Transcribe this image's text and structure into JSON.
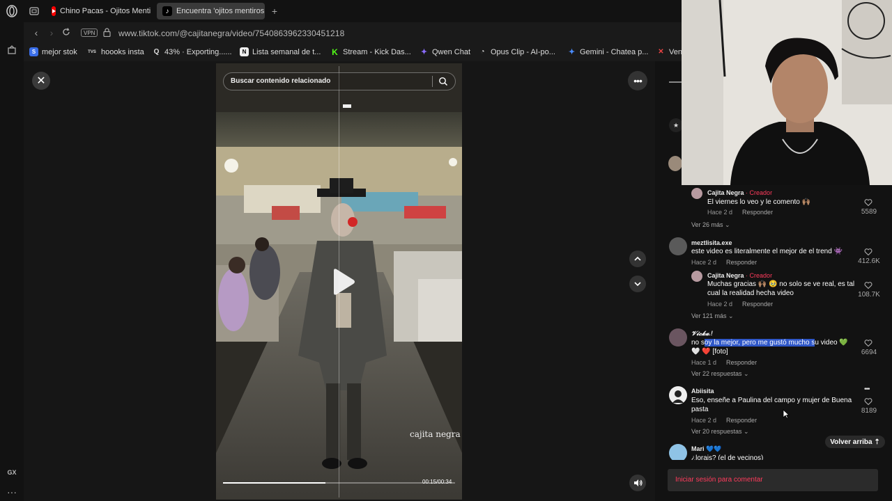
{
  "browser": {
    "tabs": [
      {
        "label": "Chino Pacas - Ojitos Menti",
        "icon": "youtube-icon",
        "active": false
      },
      {
        "label": "Encuentra 'ojitos mentiros",
        "icon": "tiktok-icon",
        "active": true
      }
    ],
    "url": "www.tiktok.com/@cajitanegra/video/7540863962330451218",
    "vpn_label": "VPN",
    "sidebar_gx": "GX",
    "bookmarks": [
      {
        "label": "mejor stok",
        "icon": "s-icon",
        "color": "#3a6ee8"
      },
      {
        "label": "hoooks insta",
        "icon": "tvs-icon",
        "color": "#444"
      },
      {
        "label": "43% · Exporting......",
        "icon": "q-icon",
        "color": "#333"
      },
      {
        "label": "Lista semanal de t...",
        "icon": "notion-icon",
        "color": "#eee"
      },
      {
        "label": "Stream - Kick Das...",
        "icon": "kick-icon",
        "color": "#53fc18"
      },
      {
        "label": "Qwen Chat",
        "icon": "qwen-icon",
        "color": "#6b4cf6"
      },
      {
        "label": "Opus Clip - AI-po...",
        "icon": "opus-icon",
        "color": "#333"
      },
      {
        "label": "Gemini - Chatea p...",
        "icon": "gemini-icon",
        "color": "#4a8cff"
      },
      {
        "label": "Ven",
        "icon": "ven-icon",
        "color": "#c33"
      }
    ]
  },
  "video": {
    "search_placeholder": "Buscar contenido relacionado",
    "watermark": "cajita negra",
    "time": "00:15/00:34",
    "progress": 0.44
  },
  "comments": {
    "items": [
      {
        "type": "reply",
        "name": "Cajita Negra",
        "creator_label": "· Creador",
        "text": "El viernes lo veo y le comento 🙌🏽",
        "time": "Hace 2 d",
        "reply": "Responder",
        "likes": "5589"
      },
      {
        "type": "more",
        "text": "Ver 26 más"
      },
      {
        "type": "comment",
        "name": "meztlisita.exe",
        "text": "este video es literalmente el mejor de el trend 👾",
        "time": "Hace 2 d",
        "reply": "Responder",
        "likes": "412.6K"
      },
      {
        "type": "reply",
        "name": "Cajita Negra",
        "creator_label": "· Creador",
        "text": "Muchas gracias 🙌🏽 🥹 no solo se ve real, es tal cual la realidad hecha video",
        "time": "Hace 2 d",
        "reply": "Responder",
        "likes": "108.7K"
      },
      {
        "type": "more",
        "text": "Ver 121 más"
      },
      {
        "type": "comment",
        "name": "𝓥𝓲𝓬𝓴𝓪.!",
        "text_pre": "no s",
        "text_hl": "oy la mejor, pero me gustó mucho s",
        "text_post": "u video 💚",
        "text_line2": "🤍 ❤️ [foto]",
        "time": "Hace 1 d",
        "reply": "Responder",
        "likes": "6694"
      },
      {
        "type": "more",
        "text": "Ver 22 respuestas"
      },
      {
        "type": "comment",
        "name": "Abiisita",
        "text": "Eso, enseñe a Paulina del campo y mujer de Buena pasta",
        "time": "Hace 2 d",
        "reply": "Responder",
        "likes": "8189"
      },
      {
        "type": "more",
        "text": "Ver 20 respuestas"
      },
      {
        "type": "comment",
        "name": "Mari 💙💙",
        "text": "¿lorais? (el de vecinos)",
        "likes": ""
      }
    ],
    "volver_arriba": "Volver arriba",
    "login_prompt": "Iniciar sesión para comentar"
  },
  "colors": {
    "accent": "#ff3b5c",
    "panel": "#121212",
    "highlight": "#2f57c8"
  }
}
